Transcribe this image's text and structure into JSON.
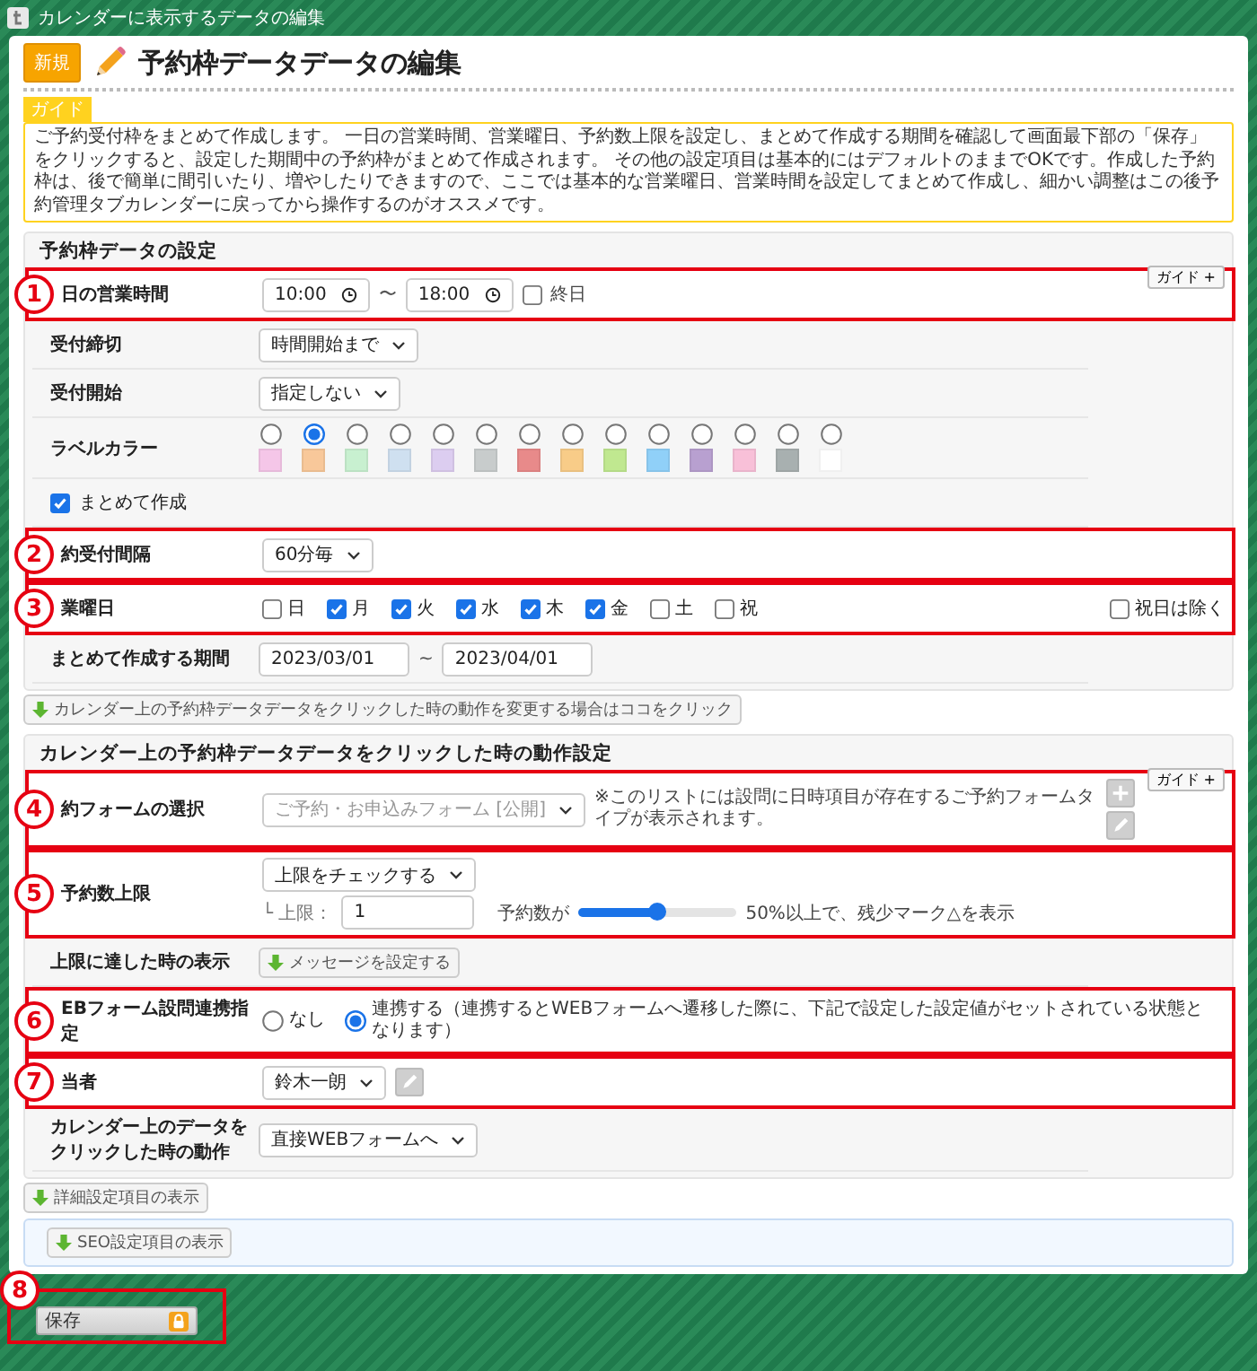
{
  "window": {
    "title": "カレンダーに表示するデータの編集"
  },
  "header": {
    "badge": "新規",
    "title": "予約枠データデータの編集"
  },
  "guide": {
    "tag": "ガイド",
    "text": "ご予約受付枠をまとめて作成します。 一日の営業時間、営業曜日、予約数上限を設定し、まとめて作成する期間を確認して画面最下部の「保存」をクリックすると、設定した期間中の予約枠がまとめて作成されます。 その他の設定項目は基本的にはデフォルトのままでOKです。作成した予約枠は、後で簡単に間引いたり、増やしたりできますので、ここでは基本的な営業曜日、営業時間を設定してまとめて作成し、細かい調整はこの後予約管理タブカレンダーに戻ってから操作するのがオススメです。"
  },
  "slot_settings": {
    "title": "予約枠データの設定",
    "guide_button": "ガイド +",
    "rows": [
      {
        "kind": "time_range",
        "annotation": "1",
        "label": "日の営業時間",
        "start": "10:00",
        "separator": "〜",
        "end": "18:00",
        "all_day": {
          "label": "終日",
          "checked": false
        }
      },
      {
        "kind": "select",
        "label": "受付締切",
        "value": "時間開始まで"
      },
      {
        "kind": "select",
        "label": "受付開始",
        "value": "指定しない"
      },
      {
        "kind": "colors",
        "label": "ラベルカラー",
        "options": [
          {
            "color": "#f5c6e8",
            "selected": false
          },
          {
            "color": "#f8c89a",
            "selected": true
          },
          {
            "color": "#c8f0d0",
            "selected": false
          },
          {
            "color": "#cfe0f0",
            "selected": false
          },
          {
            "color": "#dccdf0",
            "selected": false
          },
          {
            "color": "#c8cccc",
            "selected": false
          },
          {
            "color": "#e88a8a",
            "selected": false
          },
          {
            "color": "#f8cc88",
            "selected": false
          },
          {
            "color": "#c0e890",
            "selected": false
          },
          {
            "color": "#90d0f8",
            "selected": false
          },
          {
            "color": "#b8a0d0",
            "selected": false
          },
          {
            "color": "#f8c0d8",
            "selected": false
          },
          {
            "color": "#a8b0b0",
            "selected": false
          },
          {
            "color": "#ffffff",
            "selected": false
          }
        ]
      },
      {
        "kind": "checkbox_line",
        "label": "まとめて作成",
        "checked": true
      },
      {
        "kind": "select",
        "annotation": "2",
        "label": "約受付間隔",
        "value": "60分毎"
      },
      {
        "kind": "weekdays",
        "annotation": "3",
        "label": "業曜日",
        "days": [
          {
            "label": "日",
            "checked": false
          },
          {
            "label": "月",
            "checked": true
          },
          {
            "label": "火",
            "checked": true
          },
          {
            "label": "水",
            "checked": true
          },
          {
            "label": "木",
            "checked": true
          },
          {
            "label": "金",
            "checked": true
          },
          {
            "label": "土",
            "checked": false
          },
          {
            "label": "祝",
            "checked": false
          }
        ],
        "exclude_holidays": {
          "label": "祝日は除く",
          "checked": false
        }
      },
      {
        "kind": "date_range",
        "label": "まとめて作成する期間",
        "start": "2023/03/01",
        "separator": "~",
        "end": "2023/04/01"
      }
    ]
  },
  "change_link": "カレンダー上の予約枠データデータをクリックした時の動作を変更する場合はココをクリック",
  "click_settings": {
    "title": "カレンダー上の予約枠データデータをクリックした時の動作設定",
    "guide_button": "ガイド +",
    "rows": [
      {
        "kind": "form_select",
        "annotation": "4",
        "label": "約フォームの選択",
        "value": "ご予約・お申込みフォーム [公開]",
        "disabled": true,
        "note": "※このリストには設問に日時項目が存在するご予約フォームタイプが表示されます。"
      },
      {
        "kind": "limit",
        "annotation": "5",
        "label": "予約数上限",
        "value": "上限をチェックする",
        "limit_label": "└ 上限：",
        "limit_value": "1",
        "slider_label": "予約数が",
        "level": 0.5,
        "reading": "50%以上で、残少マーク△を表示"
      },
      {
        "kind": "button",
        "label": "上限に達した時の表示",
        "button": "メッセージを設定する"
      },
      {
        "kind": "radio",
        "annotation": "6",
        "label": "EBフォーム設問連携指定",
        "options": [
          {
            "label": "なし",
            "selected": false
          },
          {
            "label": "連携する（連携するとWEBフォームへ遷移した際に、下記で設定した設定値がセットされている状態となります）",
            "selected": true
          }
        ]
      },
      {
        "kind": "staff",
        "annotation": "7",
        "label": "当者",
        "value": "鈴木一朗"
      },
      {
        "kind": "select",
        "label": "カレンダー上のデータをクリックした時の動作",
        "value": "直接WEBフォームへ"
      }
    ]
  },
  "detail_button": "詳細設定項目の表示",
  "seo_button": "SEO設定項目の表示",
  "footer": {
    "save_button": "保存",
    "annotation": "8"
  }
}
